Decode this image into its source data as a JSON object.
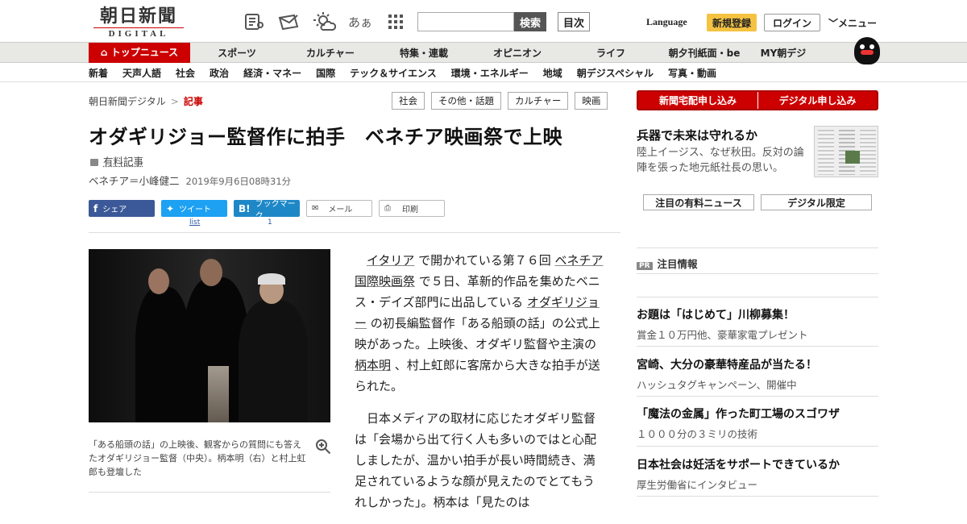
{
  "header": {
    "logo_main": "朝日新聞",
    "logo_sub": "DIGITAL",
    "icons": [
      "newspaper-icon",
      "mail-icon",
      "weather-icon",
      "font-size-icon",
      "grid-icon"
    ],
    "font_icon_text": "あぁ",
    "search_placeholder": "",
    "search_label": "検索",
    "toc_label": "目次",
    "language_label": "Language",
    "register_label": "新規登録",
    "login_label": "ログイン",
    "menu_label": "メニュー"
  },
  "nav_primary": [
    {
      "label": "トップニュース",
      "active": true
    },
    {
      "label": "スポーツ"
    },
    {
      "label": "カルチャー"
    },
    {
      "label": "特集・連載"
    },
    {
      "label": "オピニオン"
    },
    {
      "label": "ライフ"
    },
    {
      "label": "朝夕刊紙面・be"
    },
    {
      "label": "MY朝デジ"
    }
  ],
  "nav_secondary": [
    "新着",
    "天声人語",
    "社会",
    "政治",
    "経済・マネー",
    "国際",
    "テック＆サイエンス",
    "環境・エネルギー",
    "地域",
    "朝デジスペシャル",
    "写真・動画"
  ],
  "breadcrumb": {
    "home": "朝日新聞デジタル",
    "separator": ">",
    "current": "記事"
  },
  "tags": [
    "社会",
    "その他・話題",
    "カルチャー",
    "映画"
  ],
  "subscribe": {
    "newspaper": "新聞宅配申し込み",
    "digital": "デジタル申し込み"
  },
  "article": {
    "title": "オダギリジョー監督作に拍手　ベネチア映画祭で上映",
    "paid_label": "有料記事",
    "author": "ベネチア＝小峰健二",
    "date": "2019年9月6日08時31分",
    "share": {
      "facebook": "シェア",
      "twitter": "ツイート",
      "hatena": "ブックマーク",
      "mail": "メール",
      "print": "印刷"
    },
    "tweet_count": "list",
    "bookmark_count": "1",
    "caption": "「ある船頭の話」の上映後、観客からの質問にも答えたオダギリジョー監督（中央）。柄本明（右）と村上虹郎も登壇した",
    "p1": {
      "a": "イタリア",
      "b": " で開かれている第７６回 ",
      "c": "ベネチア国際映画祭",
      "d": " で５日、革新的作品を集めたベニス・デイズ部門に出品している ",
      "e": "オダギリジョー",
      "f": " の初長編監督作「ある船頭の話」の公式上映があった。上映後、オダギリ監督や主演の ",
      "g": "柄本明",
      "h": " 、村上虹郎に客席から大きな拍手が送られた。"
    },
    "p2": "日本メディアの取材に応じたオダギリ監督は「会場から出て行く人も多いのではと心配しましたが、温かい拍手が長い時間続き、満足されているような顔が見えたのでとてもうれしかった」。柄本は「見たのは"
  },
  "sidebar": {
    "feature": {
      "title": "兵器で未来は守れるか",
      "desc": "陸上イージス、なぜ秋田。反対の論陣を張った地元紙社長の思い。"
    },
    "buttons": [
      "注目の有料ニュース",
      "デジタル限定"
    ],
    "pr_badge": "PR",
    "pr_heading": "注目情報",
    "pr_items": [
      {
        "title": "お題は「はじめて」川柳募集！",
        "desc": "賞金１０万円他、豪華家電プレゼント"
      },
      {
        "title": "宮崎、大分の豪華特産品が当たる！",
        "desc": "ハッシュタグキャンペーン、開催中"
      },
      {
        "title": "「魔法の金属」作った町工場のスゴワザ",
        "desc": "１０００分の３ミリの技術"
      },
      {
        "title": "日本社会は妊活をサポートできているか",
        "desc": "厚生労働省にインタビュー"
      }
    ]
  },
  "colors": {
    "accent": "#cc0000",
    "register": "#f5c342",
    "facebook": "#3b5998",
    "twitter": "#1da1f2",
    "hatena": "#1e88c7"
  }
}
